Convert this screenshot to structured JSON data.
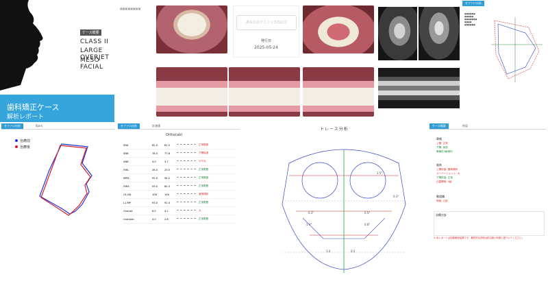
{
  "cover": {
    "badge": "ケース概要",
    "lines": [
      "CLASS II",
      "LARGE OVERJET",
      "MESO FACIAL"
    ],
    "banner_title": "歯科矯正ケース",
    "banner_subtitle": "解析レポート",
    "clinic_logo_placeholder": "あなたのクリニックのロゴ",
    "issue_label": "発行日",
    "issue_date": "2025-05-24"
  },
  "tabs": {
    "overlay": [
      "セファロ分析",
      "Bjork"
    ],
    "measure": [
      "セファロ分析",
      "計測値"
    ],
    "trace": "トレース分析",
    "summary": [
      "ケース概要",
      "所見"
    ]
  },
  "legend": {
    "items": [
      {
        "label": "治療前",
        "color": "#1e33d8"
      },
      {
        "label": "治療後",
        "color": "#d31c2c"
      }
    ]
  },
  "measure": {
    "title": "Ortho(ab)",
    "rows": [
      {
        "name": "SNA",
        "v1": "82.0",
        "v2": "81.5",
        "flag": "正常範囲",
        "flag_class": "red"
      },
      {
        "name": "SNB",
        "v1": "78.0",
        "v2": "77.8",
        "flag": "下顎後退",
        "flag_class": "red"
      },
      {
        "name": "ANB",
        "v1": "4.0",
        "v2": "3.7",
        "flag": "やや大",
        "flag_class": "red"
      },
      {
        "name": "FMA",
        "v1": "26.0",
        "v2": "25.5",
        "flag": "正常範囲",
        "flag_class": "green"
      },
      {
        "name": "IMPA",
        "v1": "95.0",
        "v2": "94.2",
        "flag": "正常範囲",
        "flag_class": "green"
      },
      {
        "name": "FMIA",
        "v1": "59.0",
        "v2": "60.3",
        "flag": "正常範囲",
        "flag_class": "green"
      },
      {
        "name": "U1-SN",
        "v1": "108",
        "v2": "106",
        "flag": "唇側傾斜",
        "flag_class": "red"
      },
      {
        "name": "L1-MP",
        "v1": "93.0",
        "v2": "92.4",
        "flag": "正常範囲",
        "flag_class": "green"
      },
      {
        "name": "Overjet",
        "v1": "6.5",
        "v2": "4.1",
        "flag": "大",
        "flag_class": "red"
      },
      {
        "name": "Overbite",
        "v1": "3.0",
        "v2": "2.8",
        "flag": "正常範囲",
        "flag_class": "green"
      }
    ]
  },
  "trace": {
    "labels": [
      "1.5°",
      "0.3°",
      "0.3°",
      "0.5°",
      "1.4°",
      "0.8°",
      "1.0",
      "0.5"
    ]
  },
  "summary": {
    "sections": [
      {
        "title": "骨格",
        "items": [
          "上顎: 正常",
          "下顎: 後退",
          "骨格性II級傾向"
        ]
      },
      {
        "title": "歯系",
        "items": [
          "上顎前歯: 唇側傾斜",
          "オーバージェット: 大",
          "下顎前歯: 正常",
          "臼歯関係: II級"
        ]
      },
      {
        "title": "軟組織",
        "items": [
          "側貌: 凸型"
        ]
      },
      {
        "title": "治療方針",
        "items": []
      }
    ],
    "note": "※ 本レポートは自動解析結果です。最終的な診断は担当医の判断に基づいてください。"
  },
  "colors": {
    "accent": "#2e9cd6",
    "red": "#d31c2c",
    "blue": "#1e33d8"
  }
}
